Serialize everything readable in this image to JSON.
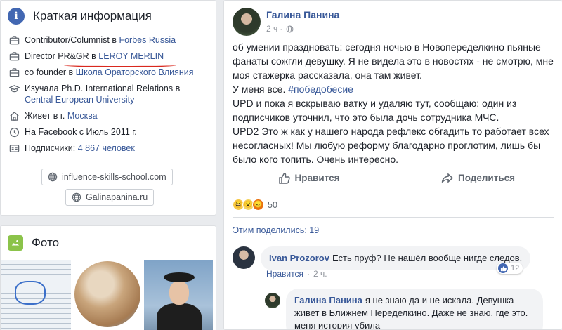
{
  "intro": {
    "title": "Краткая информация",
    "rows": [
      {
        "icon": "briefcase-icon",
        "prefix": "Contributor/Columnist в ",
        "link": "Forbes Russia"
      },
      {
        "icon": "briefcase-icon",
        "prefix": "Director PR&GR в ",
        "link": "LEROY MERLIN"
      },
      {
        "icon": "briefcase-icon",
        "prefix": "co founder в ",
        "link": "Школа Ораторского Влияния"
      },
      {
        "icon": "graduation-cap-icon",
        "prefix": "Изучала Ph.D. International Relations в ",
        "link": "Central European University"
      },
      {
        "icon": "home-icon",
        "prefix": "Живет в г. ",
        "link": "Москва"
      },
      {
        "icon": "clock-icon",
        "prefix": "На Facebook с Июль 2011 г.",
        "link": ""
      },
      {
        "icon": "followers-icon",
        "prefix": "Подписчики: ",
        "link": "4 867 человек"
      }
    ],
    "websites": [
      "influence-skills-school.com",
      "Galinapanina.ru"
    ]
  },
  "photos": {
    "title": "Фото"
  },
  "post": {
    "author": "Галина Панина",
    "time": "2 ч",
    "paragraphs": [
      "об умении праздновать: сегодня ночью в Новопеределкино пьяные фанаты сожгли девушку. Я не видела это в новостях - не смотрю, мне моя стажерка рассказала, она там живет.",
      "UPD и пока я вскрываю ватку и удаляю тут, сообщаю: один из подписчиков уточнил, что это была дочь сотрудника МЧС.",
      "UPD2 Это ж как у нашего народа рефлекс обгадить то работает всех несогласных! Мы любую реформу благодарно проглотим, лишь бы было кого топить. Очень интересно."
    ],
    "line_everyone": "У меня все. ",
    "hashtag": "#победобесие",
    "like_label": "Нравится",
    "share_label": "Поделиться",
    "reaction_count": "50",
    "shares_text": "Этим поделились: 19"
  },
  "comments": [
    {
      "author": "Ivan Prozorov",
      "text": "Есть пруф? Не нашёл вообще нигде следов.",
      "like_label": "Нравится",
      "time": "2 ч.",
      "likes": "12"
    },
    {
      "author": "Галина Панина",
      "text": "я не знаю да и не искала. Девушка живет в Ближнем Переделкино. Даже не знаю, где это. меня история убила"
    }
  ],
  "colors": {
    "link": "#385898",
    "brand": "#4267b2",
    "annotation": "#d9281e"
  }
}
